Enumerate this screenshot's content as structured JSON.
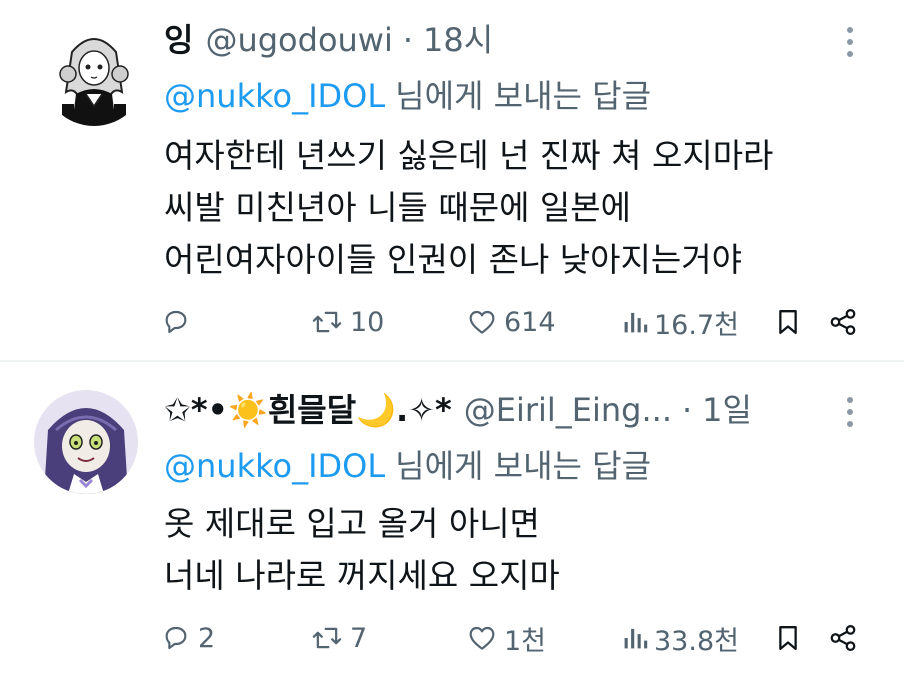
{
  "colors": {
    "accent": "#1d9bf0",
    "text_primary": "#0f1419",
    "text_secondary": "#536471",
    "divider": "#eff3f4"
  },
  "tweets": [
    {
      "display_name": "잉",
      "handle": "@ugodouwi",
      "separator": "·",
      "time": "18시",
      "reply_to_mention": "@nukko_IDOL",
      "reply_to_suffix": "님에게 보내는 답글",
      "body_lines": [
        "여자한테 년쓰기 싫은데 넌 진짜 쳐 오지마라",
        "씨발 미친년아 니들 때문에 일본에",
        "어린여자아이들 인권이 존나 낮아지는거야"
      ],
      "actions": {
        "reply_icon": "reply-icon",
        "reply_count": "",
        "retweet_icon": "retweet-icon",
        "retweet_count": "10",
        "like_icon": "heart-icon",
        "like_count": "614",
        "views_icon": "bar-chart-icon",
        "views_count": "16.7천",
        "bookmark_icon": "bookmark-icon",
        "share_icon": "share-icon"
      }
    },
    {
      "display_name": "✩*•☀️흰믈달🌙.✧*",
      "handle": "@Eiril_Eing...",
      "separator": "·",
      "time": "1일",
      "reply_to_mention": "@nukko_IDOL",
      "reply_to_suffix": "님에게 보내는 답글",
      "body_lines": [
        "옷 제대로 입고 올거 아니면",
        "너네 나라로 꺼지세요 오지마"
      ],
      "actions": {
        "reply_icon": "reply-icon",
        "reply_count": "2",
        "retweet_icon": "retweet-icon",
        "retweet_count": "7",
        "like_icon": "heart-icon",
        "like_count": "1천",
        "views_icon": "bar-chart-icon",
        "views_count": "33.8천",
        "bookmark_icon": "bookmark-icon",
        "share_icon": "share-icon"
      }
    }
  ]
}
